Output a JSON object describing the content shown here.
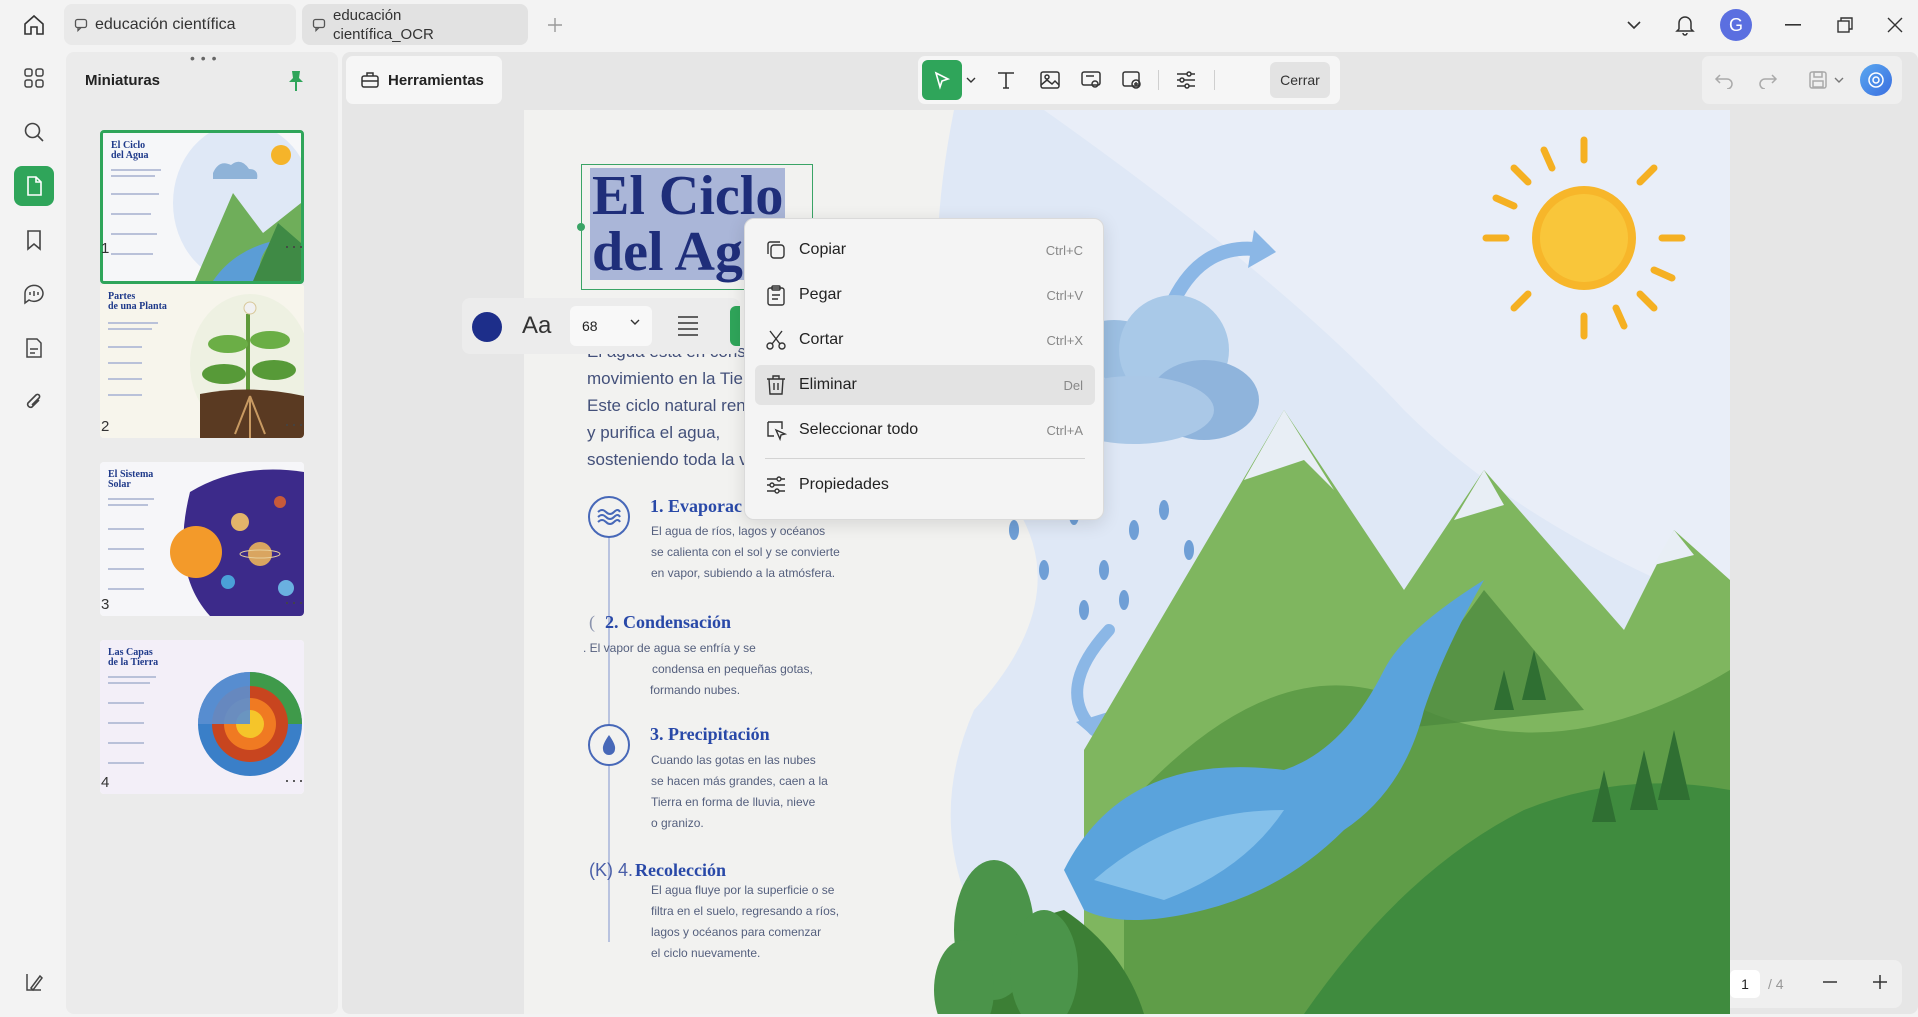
{
  "tabs": [
    {
      "label": "educación científica"
    },
    {
      "label_line1": "educación",
      "label_line2": "científica_OCR"
    }
  ],
  "user": {
    "avatar_letter": "G"
  },
  "panel": {
    "title": "Miniaturas"
  },
  "thumbnails": [
    {
      "page": "1",
      "title_line1": "El Ciclo",
      "title_line2": "del Agua"
    },
    {
      "page": "2",
      "title_line1": "Partes",
      "title_line2": "de una Planta"
    },
    {
      "page": "3",
      "title_line1": "El Sistema",
      "title_line2": "Solar"
    },
    {
      "page": "4",
      "title_line1": "Las Capas",
      "title_line2": "de la Tierra"
    }
  ],
  "toolbar": {
    "tools_label": "Herramientas",
    "close_label": "Cerrar"
  },
  "document": {
    "title_line1": "El Ciclo",
    "title_line2": "del Ag",
    "intro": [
      "El agua está en consta",
      "movimiento en la Tierr",
      "Este ciclo natural ren",
      "y purifica el agua,",
      "sosteniendo toda la vi"
    ],
    "steps": [
      {
        "title": "1. Evaporac",
        "lines": [
          "El agua de ríos, lagos y océanos",
          "se calienta con el sol y se convierte",
          "en vapor, subiendo a la atmósfera."
        ]
      },
      {
        "title": "2. Condensación",
        "prefix": "(",
        "lines": [
          ". El vapor de agua se enfría y se",
          "condensa en pequeñas gotas,",
          "formando nubes."
        ]
      },
      {
        "title": "3. Precipitación",
        "lines": [
          "Cuando las gotas en las nubes",
          "se hacen más grandes, caen a la",
          "Tierra en forma de lluvia, nieve",
          "o granizo."
        ]
      },
      {
        "title": "Recolección",
        "prefix": "(K) 4.",
        "lines": [
          "El agua fluye por la superficie o se",
          "filtra en el suelo, regresando a ríos,",
          "lagos y océanos para comenzar",
          "el ciclo nuevamente."
        ]
      }
    ]
  },
  "format_bar": {
    "font_size": "68",
    "text_color": "#1d2e8a",
    "font_icon_label": "Aa"
  },
  "context_menu": [
    {
      "label": "Copiar",
      "shortcut": "Ctrl+C"
    },
    {
      "label": "Pegar",
      "shortcut": "Ctrl+V"
    },
    {
      "label": "Cortar",
      "shortcut": "Ctrl+X"
    },
    {
      "label": "Eliminar",
      "shortcut": "Del"
    },
    {
      "label": "Seleccionar todo",
      "shortcut": "Ctrl+A"
    },
    {
      "label": "Propiedades",
      "shortcut": ""
    }
  ],
  "pagination": {
    "current": "1",
    "total": "/ 4"
  },
  "colors": {
    "accent": "#2fa55a",
    "title": "#1f2e7a",
    "step_heading": "#2949a8"
  }
}
